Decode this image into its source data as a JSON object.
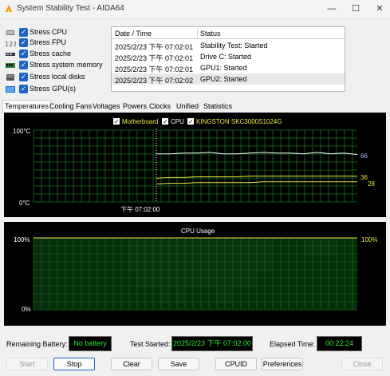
{
  "window": {
    "title": "System Stability Test - AIDA64",
    "controls": {
      "minimize": "—",
      "maximize": "☐",
      "close": "✕"
    }
  },
  "stress_options": [
    {
      "label": "Stress CPU",
      "icon": "cpu-icon",
      "checked": true
    },
    {
      "label": "Stress FPU",
      "icon": "fpu-icon",
      "checked": true
    },
    {
      "label": "Stress cache",
      "icon": "cache-icon",
      "checked": true
    },
    {
      "label": "Stress system memory",
      "icon": "memory-icon",
      "checked": true
    },
    {
      "label": "Stress local disks",
      "icon": "disk-icon",
      "checked": true
    },
    {
      "label": "Stress GPU(s)",
      "icon": "gpu-icon",
      "checked": true
    }
  ],
  "log": {
    "columns": [
      "Date / Time",
      "Status"
    ],
    "rows": [
      {
        "time": "2025/2/23 下午 07:02:01",
        "status": "Stability Test: Started"
      },
      {
        "time": "2025/2/23 下午 07:02:01",
        "status": "Drive C: Started"
      },
      {
        "time": "2025/2/23 下午 07:02:01",
        "status": "GPU1: Started"
      },
      {
        "time": "2025/2/23 下午 07:02:02",
        "status": "GPU2: Started"
      }
    ]
  },
  "tabs": [
    "Temperatures",
    "Cooling Fans",
    "Voltages",
    "Powers",
    "Clocks",
    "Unified",
    "Statistics"
  ],
  "active_tab": "Temperatures",
  "temp_chart": {
    "legend": [
      {
        "label": "Motherboard",
        "color": "#e8e84a",
        "checked": true
      },
      {
        "label": "CPU",
        "color": "#ffffff",
        "checked": true
      },
      {
        "label": "KINGSTON SKC3000S1024G",
        "color": "#e8e84a",
        "checked": true
      }
    ],
    "y_top_label": "100°C",
    "y_bottom_label": "0°C",
    "time_label": "下午 07:02:00",
    "values": [
      {
        "text": "66",
        "color": "#a8ccff"
      },
      {
        "text": "36",
        "color": "#e8e84a"
      },
      {
        "text": "28",
        "color": "#e8e84a"
      }
    ]
  },
  "cpu_chart": {
    "title": "CPU Usage",
    "y_top_left": "100%",
    "y_bottom_left": "0%",
    "y_top_right": "100%"
  },
  "chart_data": [
    {
      "type": "line",
      "ylim": [
        0,
        100
      ],
      "series": [
        {
          "name": "CPU",
          "color": "#ffffff",
          "values_before": null,
          "values_after": [
            67,
            67,
            68,
            68,
            69,
            67,
            67,
            68,
            69,
            68,
            68,
            67,
            69,
            67,
            68,
            66
          ]
        },
        {
          "name": "KINGSTON SKC3000S1024G",
          "color": "#e8e84a",
          "values_after": [
            33,
            34,
            34,
            35,
            35,
            35,
            35,
            36,
            36,
            36,
            36,
            36,
            36,
            36,
            36,
            36
          ]
        },
        {
          "name": "Motherboard",
          "color": "#e8e84a",
          "values_after": [
            25,
            26,
            26,
            27,
            27,
            27,
            27,
            27,
            28,
            28,
            28,
            28,
            28,
            28,
            28,
            28
          ]
        }
      ]
    },
    {
      "type": "area",
      "ylim": [
        0,
        100
      ],
      "series": [
        {
          "name": "CPU Usage",
          "values": [
            100,
            100,
            100,
            100,
            100,
            100,
            100,
            100,
            100,
            100
          ]
        }
      ]
    }
  ],
  "status": {
    "battery_label": "Remaining Battery:",
    "battery_value": "No battery",
    "test_started_label": "Test Started:",
    "test_started_value": "2025/2/23 下午 07:02:00",
    "elapsed_label": "Elapsed Time:",
    "elapsed_value": "00:22:24"
  },
  "buttons": {
    "start": "Start",
    "stop": "Stop",
    "clear": "Clear",
    "save": "Save",
    "cpuid": "CPUID",
    "preferences": "Preferences",
    "close": "Close"
  }
}
